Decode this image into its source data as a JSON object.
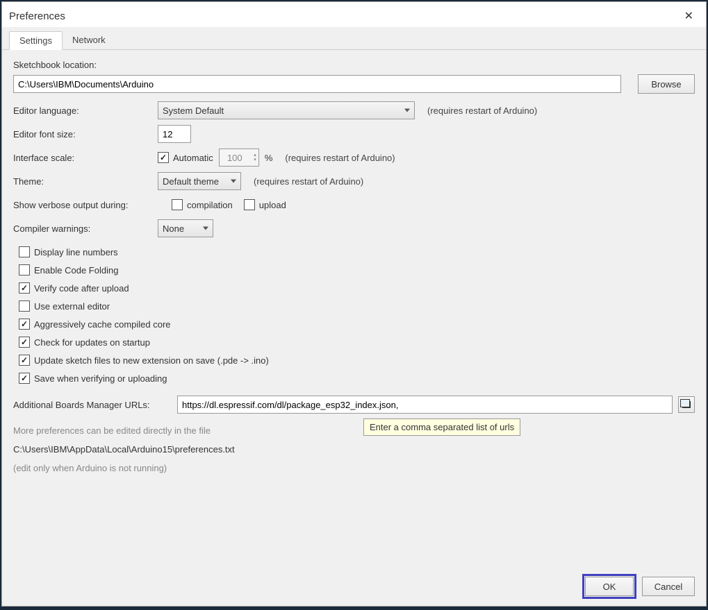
{
  "title": "Preferences",
  "tabs": {
    "settings": "Settings",
    "network": "Network"
  },
  "sketchbook": {
    "label": "Sketchbook location:",
    "value": "C:\\Users\\IBM\\Documents\\Arduino",
    "browse": "Browse"
  },
  "editorLanguage": {
    "label": "Editor language:",
    "value": "System Default",
    "hint": "(requires restart of Arduino)"
  },
  "editorFont": {
    "label": "Editor font size:",
    "value": "12"
  },
  "interfaceScale": {
    "label": "Interface scale:",
    "auto": "Automatic",
    "value": "100",
    "pct": "%",
    "hint": "(requires restart of Arduino)"
  },
  "theme": {
    "label": "Theme:",
    "value": "Default theme",
    "hint": "(requires restart of Arduino)"
  },
  "verbose": {
    "label": "Show verbose output during:",
    "compilation": "compilation",
    "upload": "upload"
  },
  "compilerWarnings": {
    "label": "Compiler warnings:",
    "value": "None"
  },
  "checks": {
    "lineNumbers": "Display line numbers",
    "codeFolding": "Enable Code Folding",
    "verifyUpload": "Verify code after upload",
    "externalEditor": "Use external editor",
    "cacheCore": "Aggressively cache compiled core",
    "checkUpdates": "Check for updates on startup",
    "updateExt": "Update sketch files to new extension on save (.pde -> .ino)",
    "saveVerify": "Save when verifying or uploading"
  },
  "boardsUrl": {
    "label": "Additional Boards Manager URLs:",
    "value": "https://dl.espressif.com/dl/package_esp32_index.json,",
    "tooltip": "Enter a comma separated list of urls"
  },
  "morePrefs": "More preferences can be edited directly in the file",
  "prefPath": "C:\\Users\\IBM\\AppData\\Local\\Arduino15\\preferences.txt",
  "editNote": "(edit only when Arduino is not running)",
  "buttons": {
    "ok": "OK",
    "cancel": "Cancel"
  }
}
